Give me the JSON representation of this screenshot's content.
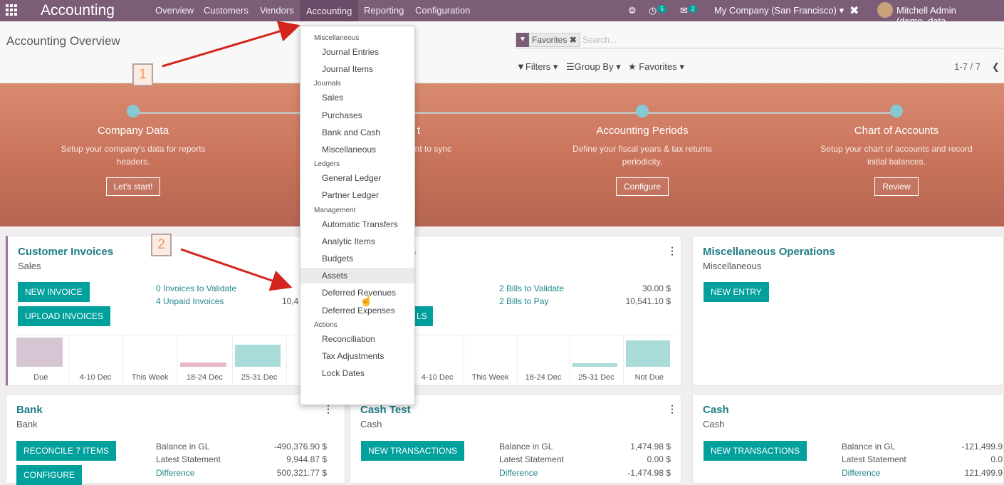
{
  "topbar": {
    "app": "Accounting",
    "menus": [
      "Overview",
      "Customers",
      "Vendors",
      "Accounting",
      "Reporting",
      "Configuration"
    ],
    "chat_count": "5",
    "msg_count": "2",
    "company": "My Company (San Francisco)",
    "user": "Mitchell Admin (demo_data"
  },
  "control_panel": {
    "breadcrumb": "Accounting Overview",
    "facet": "Favorites",
    "search_placeholder": "Search...",
    "filters": "Filters",
    "group_by": "Group By",
    "favorites": "Favorites",
    "pager": "1-7 / 7"
  },
  "onboarding": [
    {
      "title": "Company Data",
      "desc": "Setup your company's data for reports headers.",
      "button": "Let's start!"
    },
    {
      "title": "t",
      "desc": "nt to sync",
      "button": ""
    },
    {
      "title": "Accounting Periods",
      "desc": "Define your fiscal years & tax returns periodicity.",
      "button": "Configure"
    },
    {
      "title": "Chart of Accounts",
      "desc": "Setup your chart of accounts and record initial balances.",
      "button": "Review"
    }
  ],
  "dropdown": {
    "sections": [
      {
        "label": "Miscellaneous",
        "items": [
          "Journal Entries",
          "Journal Items"
        ]
      },
      {
        "label": "Journals",
        "items": [
          "Sales",
          "Purchases",
          "Bank and Cash",
          "Miscellaneous"
        ]
      },
      {
        "label": "Ledgers",
        "items": [
          "General Ledger",
          "Partner Ledger"
        ]
      },
      {
        "label": "Management",
        "items": [
          "Automatic Transfers",
          "Analytic Items",
          "Budgets",
          "Assets",
          "Deferred Revenues",
          "Deferred Expenses"
        ]
      },
      {
        "label": "Actions",
        "items": [
          "Reconciliation",
          "Tax Adjustments",
          "Lock Dates"
        ]
      }
    ],
    "hovered": "Assets"
  },
  "annotations": [
    "1",
    "2"
  ],
  "cards": {
    "customer_invoices": {
      "title": "Customer Invoices",
      "subtitle": "Sales",
      "btn1": "NEW INVOICE",
      "btn2": "UPLOAD INVOICES",
      "link1": "0 Invoices to Validate",
      "link2": "4 Unpaid Invoices",
      "amount": "10,4",
      "chart": {
        "categories": [
          "Due",
          "4-10 Dec",
          "This Week",
          "18-24 Dec",
          "25-31 Dec",
          "N"
        ],
        "values": [
          0.85,
          0,
          0,
          0.12,
          0.65,
          0
        ],
        "colors": [
          "#d6c6d4",
          "#d6c6d4",
          "#d6c6d4",
          "#e9b8c9",
          "#a9dcd9",
          "#a9dcd9"
        ]
      }
    },
    "vendor_bills": {
      "title": "s",
      "btn": "LS",
      "link1": "2 Bills to Validate",
      "link2": "2 Bills to Pay",
      "amt1": "30.00 $",
      "amt2": "10,541.10 $",
      "chart": {
        "categories": [
          "4-10 Dec",
          "This Week",
          "18-24 Dec",
          "25-31 Dec",
          "Not Due"
        ],
        "values": [
          0,
          0,
          0,
          0.1,
          0.78
        ]
      }
    },
    "misc_operations": {
      "title": "Miscellaneous Operations",
      "subtitle": "Miscellaneous",
      "btn": "NEW ENTRY"
    },
    "bank": {
      "title": "Bank",
      "subtitle": "Bank",
      "btn1": "RECONCILE 7 ITEMS",
      "btn2": "CONFIGURE",
      "l1": "Balance in GL",
      "l2": "Latest Statement",
      "l3": "Difference",
      "v1": "-490,376.90 $",
      "v2": "9,944.87 $",
      "v3": "500,321.77 $"
    },
    "cash_test": {
      "title": "Cash Test",
      "subtitle": "Cash",
      "btn": "NEW TRANSACTIONS",
      "l1": "Balance in GL",
      "l2": "Latest Statement",
      "l3": "Difference",
      "v1": "1,474.98 $",
      "v2": "0.00 $",
      "v3": "-1,474.98 $"
    },
    "cash": {
      "title": "Cash",
      "subtitle": "Cash",
      "btn": "NEW TRANSACTIONS",
      "l1": "Balance in GL",
      "l2": "Latest Statement",
      "l3": "Difference",
      "v1": "-121,499.9",
      "v2": "0.0",
      "v3": "121,499.9"
    }
  }
}
